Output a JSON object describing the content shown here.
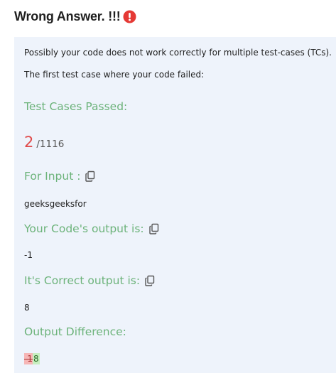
{
  "header": {
    "title": "Wrong Answer. !!!",
    "alert_icon": "exclamation-circle-icon",
    "alert_color": "#e53935"
  },
  "result": {
    "message_line1": "Possibly your code does not work correctly for multiple test-cases (TCs).",
    "message_line2": "The first test case where your code failed:",
    "test_cases_label": "Test Cases Passed:",
    "passed": "2",
    "total": "/1116",
    "input_label": "For Input :",
    "input_value": "geeksgeeksfor",
    "your_output_label": "Your Code's output is:",
    "your_output_value": "-1",
    "correct_output_label": "It's Correct output is:",
    "correct_output_value": "8",
    "difference_label": "Output Difference:",
    "diff_removed": "-1",
    "diff_added": "8"
  },
  "colors": {
    "label_green": "#6cb37a",
    "passed_red": "#e04a4a",
    "panel_bg": "#eef3fb"
  },
  "icons": {
    "copy": "copy-icon"
  }
}
